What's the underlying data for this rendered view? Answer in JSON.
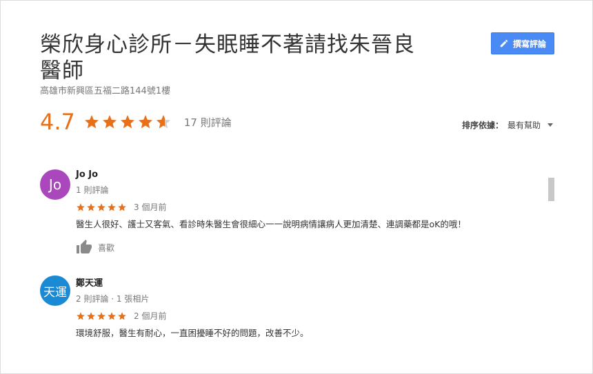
{
  "place": {
    "title": "榮欣身心診所－失眠睡不著請找朱晉良醫師",
    "address": "高雄市新興區五福二路144號1樓",
    "rating": "4.7",
    "review_count": "17 則評論"
  },
  "write_review": {
    "label": "撰寫評論"
  },
  "sort": {
    "label": "排序依據：",
    "value": "最有幫助"
  },
  "colors": {
    "star": "#e7711b",
    "button": "#4a8af4"
  },
  "reviews": [
    {
      "avatar_text": "Jo",
      "avatar_color": "#ab47bc",
      "name": "Jo Jo",
      "meta": "1 則評論",
      "stars": 5,
      "time": "3 個月前",
      "text": "醫生人很好、護士又客氣、看診時朱醫生會很細心一一說明病情讓病人更加清楚、連調藥都是oK的哦！",
      "like_label": "喜歡"
    },
    {
      "avatar_text": "天運",
      "avatar_color": "#1a8ad4",
      "name": "鄭天運",
      "meta": "2 則評論 · 1 張相片",
      "stars": 5,
      "time": "2 個月前",
      "text": "環境舒服，醫生有耐心，一直困擾睡不好的問題，改善不少。"
    }
  ]
}
